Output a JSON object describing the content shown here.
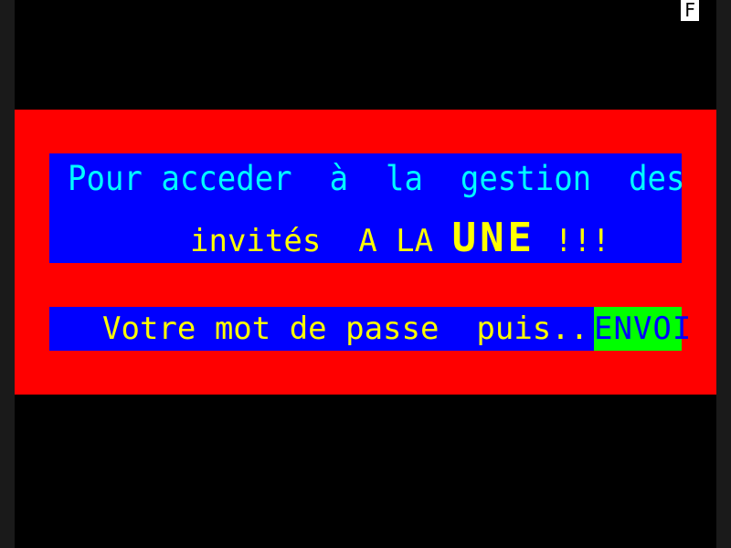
{
  "status": {
    "indicator": "F"
  },
  "message": {
    "line1": "Pour acceder  à  la  gestion  des",
    "line2_prefix": "invités  A LA ",
    "line2_emphasis": "UNE",
    "line2_suffix": " !!!"
  },
  "password_prompt": {
    "text": "Votre mot de passe  puis...",
    "key_label": "ENVOI"
  },
  "colors": {
    "background": "#000000",
    "band": "#ff0000",
    "box": "#0000ff",
    "line1_text": "#00ffff",
    "yellow_text": "#ffff00",
    "key_bg": "#00ff00",
    "key_text": "#0000ff"
  }
}
